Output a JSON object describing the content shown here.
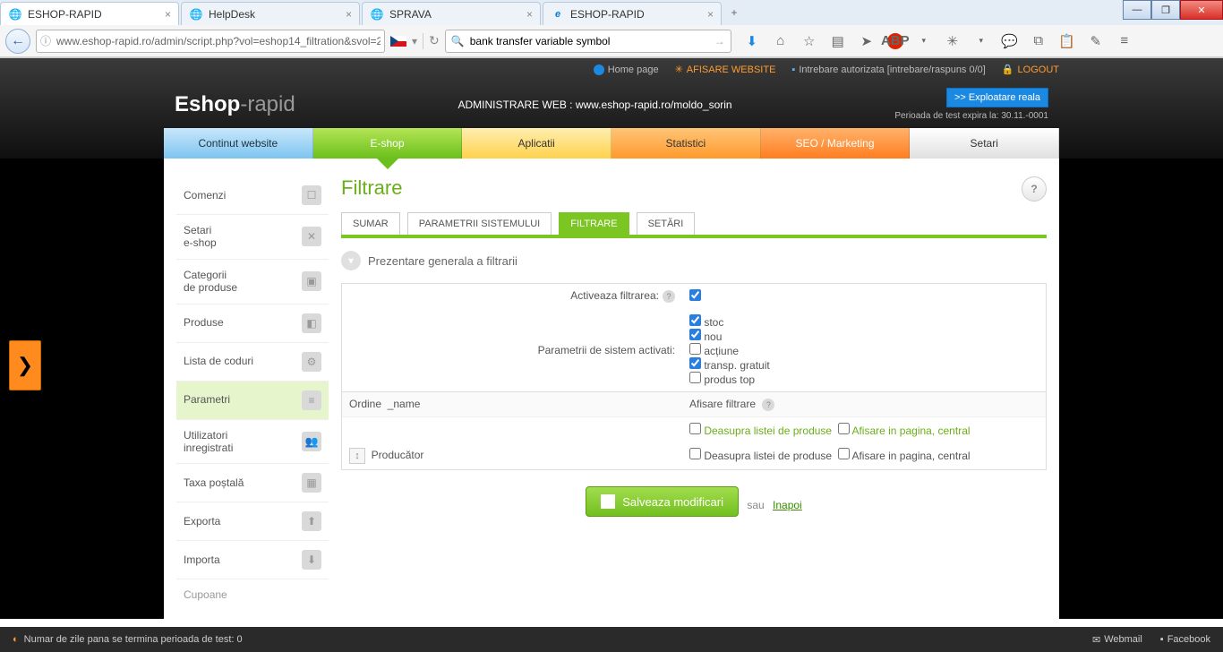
{
  "browser": {
    "tabs": [
      {
        "title": "ESHOP-RAPID"
      },
      {
        "title": "HelpDesk"
      },
      {
        "title": "SPRAVA"
      },
      {
        "title": "ESHOP-RAPID"
      }
    ],
    "url": "www.eshop-rapid.ro/admin/script.php?vol=eshop14_filtration&svol=2",
    "search": "bank transfer variable symbol"
  },
  "top": {
    "home": "Home page",
    "afisare": "AFISARE WEBSITE",
    "intrebare": "Intrebare autorizata [intrebare/raspuns 0/0]",
    "logout": "LOGOUT"
  },
  "header": {
    "logo1": "Eshop",
    "logo2": "-rapid",
    "admin": "ADMINISTRARE WEB : www.eshop-rapid.ro/moldo_sorin",
    "exploit": ">> Exploatare reala",
    "period": "Perioada de test expira la: 30.11.-0001"
  },
  "nav": {
    "continut": "Continut website",
    "eshop": "E-shop",
    "aplicatii": "Aplicatii",
    "statistici": "Statistici",
    "seo": "SEO / Marketing",
    "setari": "Setari"
  },
  "sidebar": {
    "items": [
      {
        "label": "Comenzi"
      },
      {
        "label": "Setari\ne-shop"
      },
      {
        "label": "Categorii\nde produse"
      },
      {
        "label": "Produse"
      },
      {
        "label": "Lista de coduri"
      },
      {
        "label": "Parametri"
      },
      {
        "label": "Utilizatori\ninregistrati"
      },
      {
        "label": "Taxa poștală"
      },
      {
        "label": "Exporta"
      },
      {
        "label": "Importa"
      },
      {
        "label": "Cupoane"
      }
    ]
  },
  "page": {
    "title": "Filtrare",
    "tabs": {
      "sumar": "SUMAR",
      "param": "PARAMETRII SISTEMULUI",
      "filtr": "FILTRARE",
      "setari": "SETĂRI"
    },
    "section": "Prezentare generala a filtrarii",
    "labels": {
      "activate": "Activeaza filtrarea:",
      "sysparams": "Parametrii de sistem activati:",
      "stoc": "stoc",
      "nou": "nou",
      "actiune": "acțiune",
      "transp": "transp. gratuit",
      "top": "produs top",
      "ordine": "Ordine",
      "name": "_name",
      "afisare": "Afisare filtrare",
      "deasupra": "Deasupra listei de produse",
      "central": "Afisare in pagina, central",
      "producator": "Producător"
    },
    "save": "Salveaza modificari",
    "sau": "sau",
    "inapoi": "Inapoi"
  },
  "status": {
    "left": "Numar de zile pana se termina perioada de test: 0",
    "webmail": "Webmail",
    "facebook": "Facebook"
  }
}
